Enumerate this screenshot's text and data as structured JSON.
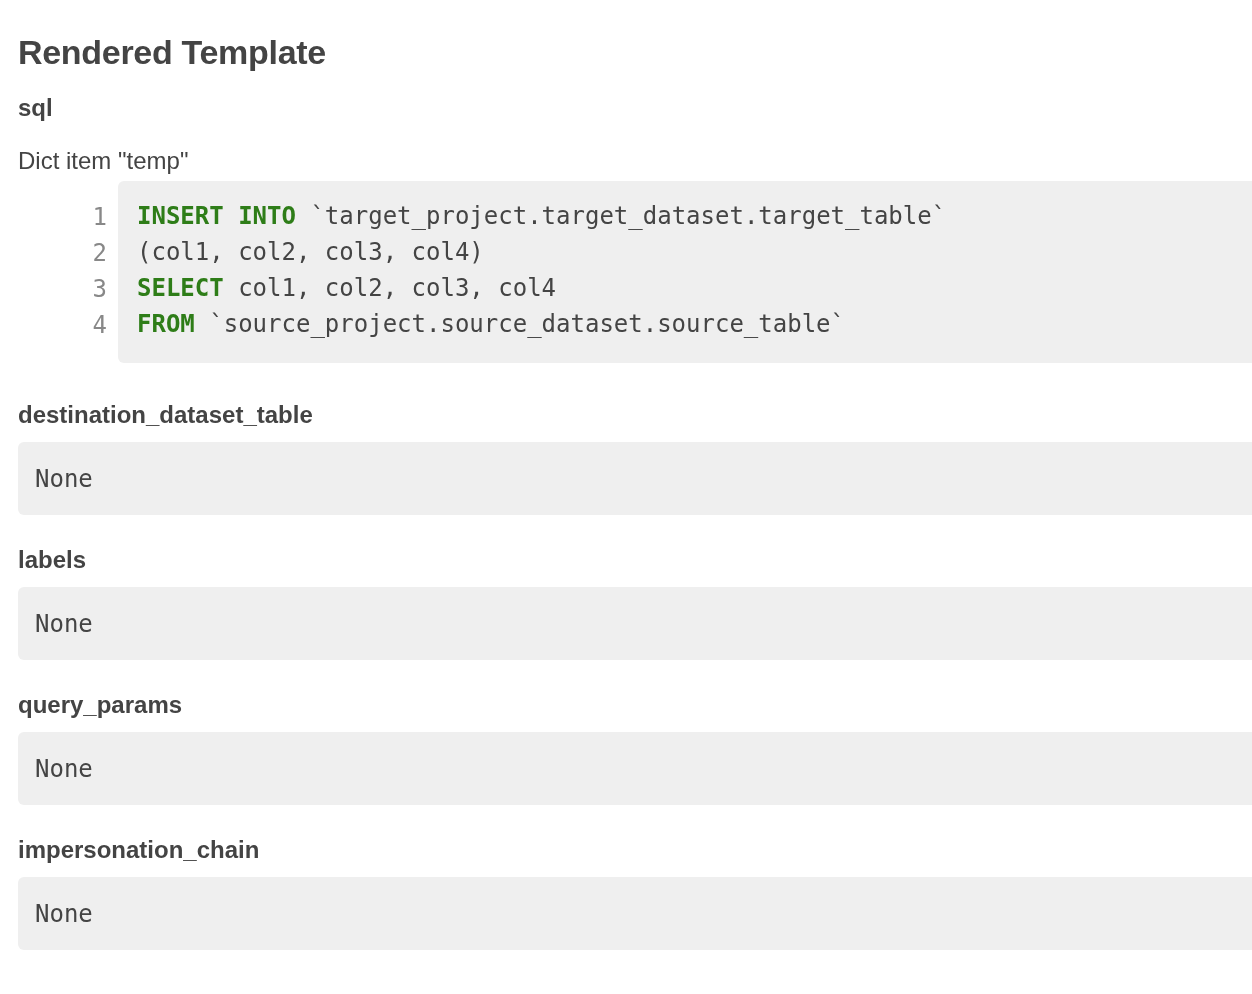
{
  "title": "Rendered Template",
  "sql": {
    "label": "sql",
    "caption": "Dict item \"temp\"",
    "lines": [
      {
        "number": "1",
        "tokens": [
          {
            "kind": "keyword",
            "text": "INSERT INTO"
          },
          {
            "kind": "plain",
            "text": " `target_project.target_dataset.target_table`"
          }
        ]
      },
      {
        "number": "2",
        "tokens": [
          {
            "kind": "plain",
            "text": "(col1, col2, col3, col4)"
          }
        ]
      },
      {
        "number": "3",
        "tokens": [
          {
            "kind": "keyword",
            "text": "SELECT"
          },
          {
            "kind": "plain",
            "text": " col1, col2, col3, col4"
          }
        ]
      },
      {
        "number": "4",
        "tokens": [
          {
            "kind": "keyword",
            "text": "FROM"
          },
          {
            "kind": "plain",
            "text": " `source_project.source_dataset.source_table`"
          }
        ]
      }
    ]
  },
  "fields": [
    {
      "label": "destination_dataset_table",
      "value": "None"
    },
    {
      "label": "labels",
      "value": "None"
    },
    {
      "label": "query_params",
      "value": "None"
    },
    {
      "label": "impersonation_chain",
      "value": "None"
    }
  ]
}
